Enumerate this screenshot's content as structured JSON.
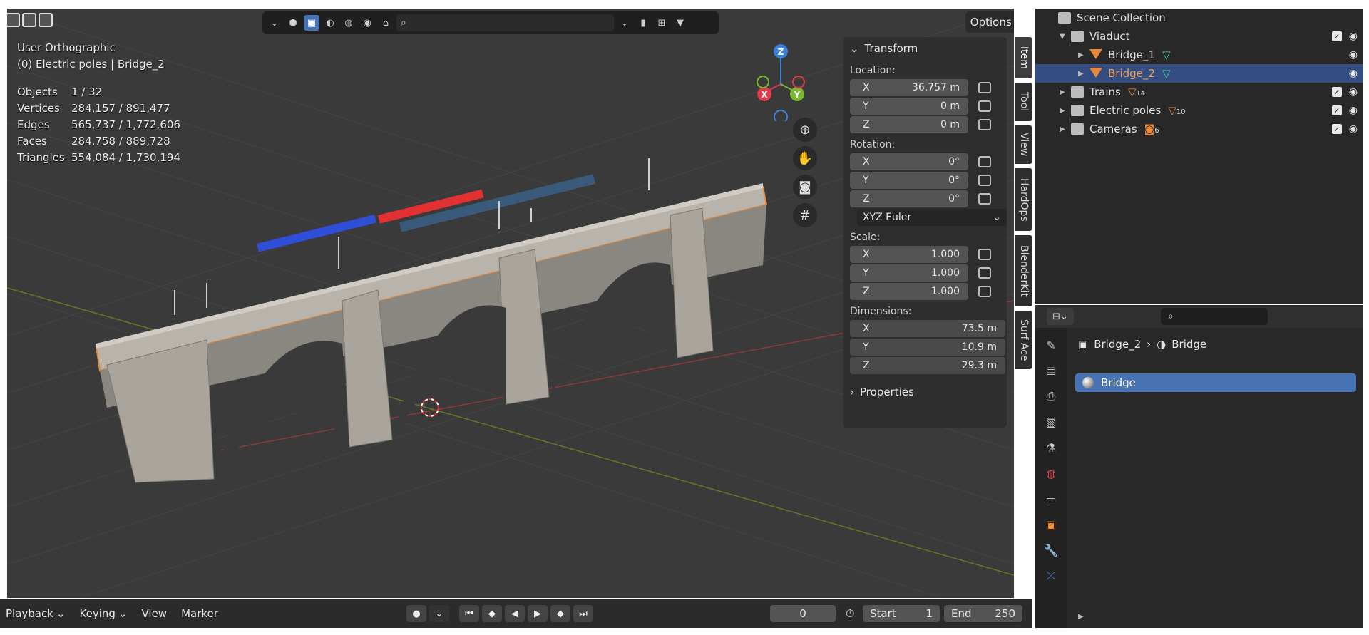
{
  "viewport": {
    "view_name": "User Orthographic",
    "context": "(0) Electric poles | Bridge_2",
    "search_placeholder": "",
    "options_label": "Options",
    "stats": [
      {
        "label": "Objects",
        "value": "1 / 32"
      },
      {
        "label": "Vertices",
        "value": "284,157 / 891,477"
      },
      {
        "label": "Edges",
        "value": "565,737 / 1,772,606"
      },
      {
        "label": "Faces",
        "value": "284,758 / 889,728"
      },
      {
        "label": "Triangles",
        "value": "554,084 / 1,730,194"
      }
    ],
    "gizmo": {
      "x": "X",
      "y": "Y",
      "z": "Z"
    }
  },
  "npanel": {
    "transform_label": "Transform",
    "location_label": "Location:",
    "location": [
      {
        "axis": "X",
        "value": "36.757 m"
      },
      {
        "axis": "Y",
        "value": "0 m"
      },
      {
        "axis": "Z",
        "value": "0 m"
      }
    ],
    "rotation_label": "Rotation:",
    "rotation": [
      {
        "axis": "X",
        "value": "0°"
      },
      {
        "axis": "Y",
        "value": "0°"
      },
      {
        "axis": "Z",
        "value": "0°"
      }
    ],
    "rotation_mode": "XYZ Euler",
    "scale_label": "Scale:",
    "scale": [
      {
        "axis": "X",
        "value": "1.000"
      },
      {
        "axis": "Y",
        "value": "1.000"
      },
      {
        "axis": "Z",
        "value": "1.000"
      }
    ],
    "dimensions_label": "Dimensions:",
    "dimensions": [
      {
        "axis": "X",
        "value": "73.5 m"
      },
      {
        "axis": "Y",
        "value": "10.9 m"
      },
      {
        "axis": "Z",
        "value": "29.3 m"
      }
    ],
    "properties_label": "Properties",
    "tabs": [
      "Item",
      "Tool",
      "View",
      "HardOps",
      "BlenderKit",
      "Surf Ace"
    ]
  },
  "timeline": {
    "menus": [
      "Playback",
      "Keying",
      "View",
      "Marker"
    ],
    "current_frame": "0",
    "start_label": "Start",
    "start_value": "1",
    "end_label": "End",
    "end_value": "250"
  },
  "outliner": {
    "root": "Scene Collection",
    "items": [
      {
        "name": "Viaduct",
        "type": "collection"
      },
      {
        "name": "Bridge_1",
        "type": "mesh"
      },
      {
        "name": "Bridge_2",
        "type": "mesh",
        "selected": true
      },
      {
        "name": "Trains",
        "type": "collection",
        "count": "14"
      },
      {
        "name": "Electric poles",
        "type": "collection",
        "count": "10"
      },
      {
        "name": "Cameras",
        "type": "collection",
        "count": "6"
      }
    ]
  },
  "properties": {
    "object_name": "Bridge_2",
    "material_name": "Bridge",
    "material_slot": "Bridge"
  },
  "colors": {
    "accent": "#4772b3",
    "selection_outline": "#e6893a",
    "axis_x": "#e0394c",
    "axis_y": "#7ab82f",
    "axis_z": "#3b7fd8"
  }
}
